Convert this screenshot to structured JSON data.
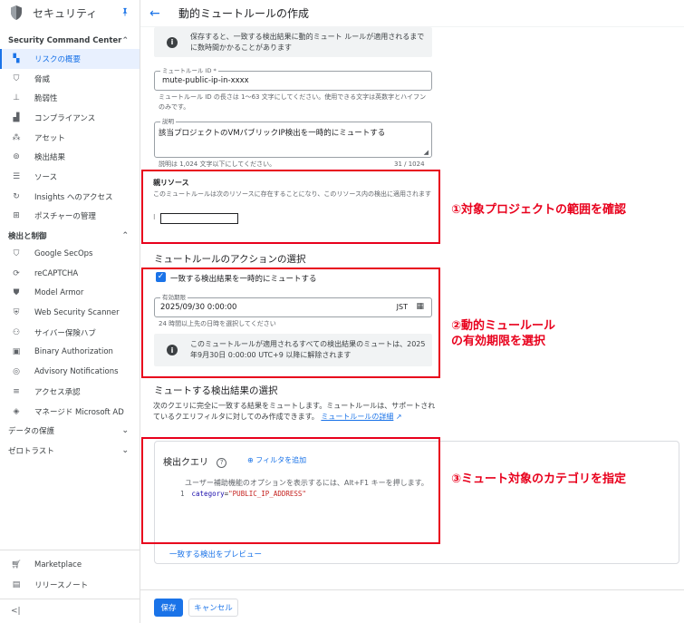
{
  "sidebar": {
    "title": "セキュリティ",
    "sections": [
      {
        "label": "Security Command Center",
        "chevron": "^"
      },
      {
        "label": "検出と制御",
        "chevron": "^"
      },
      {
        "label": "データの保護",
        "chevron": "v"
      },
      {
        "label": "ゼロトラスト",
        "chevron": "v"
      }
    ],
    "scc_items": [
      {
        "label": "リスクの概要",
        "icon": "dashboard-icon"
      },
      {
        "label": "脅威",
        "icon": "shield-icon"
      },
      {
        "label": "脆弱性",
        "icon": "download-icon"
      },
      {
        "label": "コンプライアンス",
        "icon": "bar-chart-icon"
      },
      {
        "label": "アセット",
        "icon": "hierarchy-icon"
      },
      {
        "label": "検出結果",
        "icon": "search-report-icon"
      },
      {
        "label": "ソース",
        "icon": "list-icon"
      },
      {
        "label": "Insights へのアクセス",
        "icon": "refresh-icon"
      },
      {
        "label": "ポスチャーの管理",
        "icon": "grid-icon"
      }
    ],
    "detect_items": [
      {
        "label": "Google SecOps",
        "icon": "shield-outline-icon"
      },
      {
        "label": "reCAPTCHA",
        "icon": "recaptcha-icon"
      },
      {
        "label": "Model Armor",
        "icon": "shield-check-icon"
      },
      {
        "label": "Web Security Scanner",
        "icon": "shield-web-icon"
      },
      {
        "label": "サイバー保険ハブ",
        "icon": "people-icon"
      },
      {
        "label": "Binary Authorization",
        "icon": "binary-icon"
      },
      {
        "label": "Advisory Notifications",
        "icon": "notification-icon"
      },
      {
        "label": "アクセス承認",
        "icon": "approval-icon"
      },
      {
        "label": "マネージド Microsoft AD",
        "icon": "ad-icon"
      }
    ],
    "bottom_items": [
      {
        "label": "Marketplace",
        "icon": "cart-icon"
      },
      {
        "label": "リリースノート",
        "icon": "notes-icon"
      }
    ],
    "collapse": "<|"
  },
  "header": {
    "title": "動的ミュートルールの作成"
  },
  "info_top": {
    "text": "保存すると、一致する検出結果に動的ミュート ルールが適用されるまでに数時間かかることがあります"
  },
  "mute_id": {
    "label": "ミュートルール ID *",
    "value": "mute-public-ip-in-xxxx",
    "hint": "ミュートルール ID の長さは 1〜63 文字にしてください。使用できる文字は英数字とハイフンのみです。"
  },
  "description": {
    "label": "説明",
    "value": "該当プロジェクトのVMパブリックIP検出を一時的にミュートする",
    "hint": "説明は 1,024 文字以下にしてください。",
    "count": "31 / 1024"
  },
  "parent": {
    "title": "親リソース",
    "desc": "このミュートルールは次のリソースに存在することになり、このリソース内の検出に適用されます"
  },
  "action": {
    "title": "ミュートルールのアクションの選択",
    "checkbox_label": "一致する検出結果を一時的にミュートする",
    "expiry_label": "有効期限",
    "expiry_value": "2025/09/30 0:00:00",
    "timezone": "JST",
    "expiry_hint": "24 時間以上先の日時を選択してください",
    "info": "このミュートルールが適用されるすべての検出結果のミュートは、2025年9月30日 0:00:00 UTC+9 以降に解除されます"
  },
  "findings": {
    "title": "ミュートする検出結果の選択",
    "desc": "次のクエリに完全に一致する結果をミュートします。ミュートルールは、サポートされているクエリフィルタに対してのみ作成できます。",
    "link": "ミュートルールの詳細",
    "query_title": "検出クエリ",
    "add_filter": "フィルタを追加",
    "accessibility": "ユーザー補助機能のオプションを表示するには、Alt+F1 キーを押します。",
    "line_no": "1",
    "code_key": "category",
    "code_eq": "=",
    "code_value": "\"PUBLIC_IP_ADDRESS\"",
    "preview": "一致する検出をプレビュー"
  },
  "buttons": {
    "save": "保存",
    "cancel": "キャンセル"
  },
  "annotations": {
    "a1": "①対象プロジェクトの範囲を確認",
    "a2_line1": "②動的ミュールール",
    "a2_line2": "の有効期限を選択",
    "a3": "③ミュート対象のカテゴリを指定"
  },
  "colors": {
    "accent": "#1a73e8",
    "annotation": "#e8001c"
  }
}
